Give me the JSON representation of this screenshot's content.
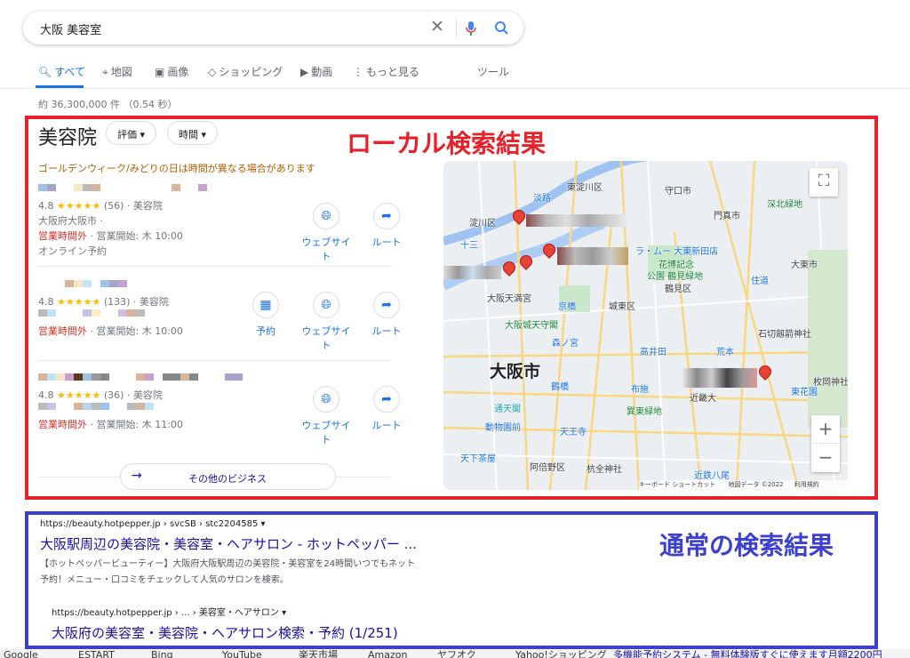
{
  "search": {
    "query": "大阪 美容室"
  },
  "tabs": [
    {
      "label": "すべて",
      "icon": "search-icon"
    },
    {
      "label": "地図",
      "icon": "map-pin-icon"
    },
    {
      "label": "画像",
      "icon": "image-icon"
    },
    {
      "label": "ショッピング",
      "icon": "tag-icon"
    },
    {
      "label": "動画",
      "icon": "play-icon"
    },
    {
      "label": "もっと見る",
      "icon": "more-vert-icon"
    }
  ],
  "tools": "ツール",
  "stats": "約 36,300,000 件 （0.54 秒）",
  "annotations": {
    "local": "ローカル検索結果",
    "organic": "通常の検索結果",
    "local_color": "#e8202a",
    "organic_color": "#3c3fd0"
  },
  "local": {
    "title": "美容院",
    "filters": [
      "評価",
      "時間"
    ],
    "notice": "ゴールデンウィーク/みどりの日は時間が異なる場合があります",
    "businesses": [
      {
        "rating": "4.8",
        "stars": 5,
        "reviews": "(56)",
        "category": "美容院",
        "address": "大阪府大阪市",
        "status": "営業時間外",
        "hours": "営業開始: 木 10:00",
        "extra": "オンライン予約",
        "actions": [
          "ウェブサイト",
          "ルート"
        ]
      },
      {
        "rating": "4.8",
        "stars": 5,
        "reviews": "(133)",
        "category": "美容院",
        "status": "営業時間外",
        "hours": "営業開始: 木 10:00",
        "actions": [
          "予約",
          "ウェブサイト",
          "ルート"
        ]
      },
      {
        "rating": "4.8",
        "stars": 5,
        "reviews": "(36)",
        "category": "美容院",
        "status": "営業時間外",
        "hours": "営業開始: 木 11:00",
        "actions": [
          "ウェブサイト",
          "ルート"
        ]
      }
    ],
    "more": "その他のビジネス"
  },
  "map": {
    "labels": {
      "higashiyodogawa": "東淀川区",
      "moriguchi": "守口市",
      "awaji": "淡路",
      "yodogawa": "淀川区",
      "kadoma": "門真市",
      "fukakita": "深北緑地",
      "juso": "十三",
      "lamu": "ラ・ムー 大東新田店",
      "hanahaku": "花博記念",
      "tsurumi_park": "公園 鶴見緑地",
      "daito": "大東市",
      "suminodo": "住道",
      "tsurumi": "鶴見区",
      "tenmangu": "大阪天満宮",
      "kyobashi": "京橋",
      "joto": "城東区",
      "osakajo": "大阪城天守閣",
      "ishikiri": "石切劔箭神社",
      "morinomiya": "森ノ宮",
      "takaida": "高井田",
      "aramoto": "荒本",
      "osakashi": "大阪市",
      "tsuruhashi": "鶴橋",
      "fuse": "布施",
      "kindai": "近畿大",
      "higashihanazono": "東花園",
      "hiraoka": "枚岡神社",
      "tsutenkaku": "通天閣",
      "tatsumi": "巽東緑地",
      "dobutsuen": "動物園前",
      "tennoji": "天王寺",
      "tengachaya": "天下茶屋",
      "abeno": "阿倍野区",
      "kumata": "杭全神社",
      "kintetsuyao": "近鉄八尾"
    },
    "footer": {
      "shortcuts": "キーボード ショートカット",
      "data": "地図データ ©2022",
      "terms": "利用規約"
    }
  },
  "organic": [
    {
      "url": "https://beauty.hotpepper.jp › svcSB › stc2204585",
      "title": "大阪駅周辺の美容院・美容室・ヘアサロン - ホットペッパー ...",
      "snippet1": "【ホットペッパービューティー】大阪府大阪駅周辺の美容院・美容室を24時間いつでもネット",
      "snippet2": "予約！メニュー・口コミをチェックして人気のサロンを検索。"
    },
    {
      "url": "https://beauty.hotpepper.jp › ... › 美容室・ヘアサロン",
      "title": "大阪府の美容室・美容院・ヘアサロン検索・予約 (1/251)"
    }
  ],
  "bookmarks": [
    "Google",
    "ESTART",
    "Bing",
    "YouTube",
    "楽天市場",
    "Amazon",
    "ヤフオク",
    "Yahoo!ショッピング",
    "多機能予約システム - 無料体験版すぐに使えます月額2200円"
  ]
}
